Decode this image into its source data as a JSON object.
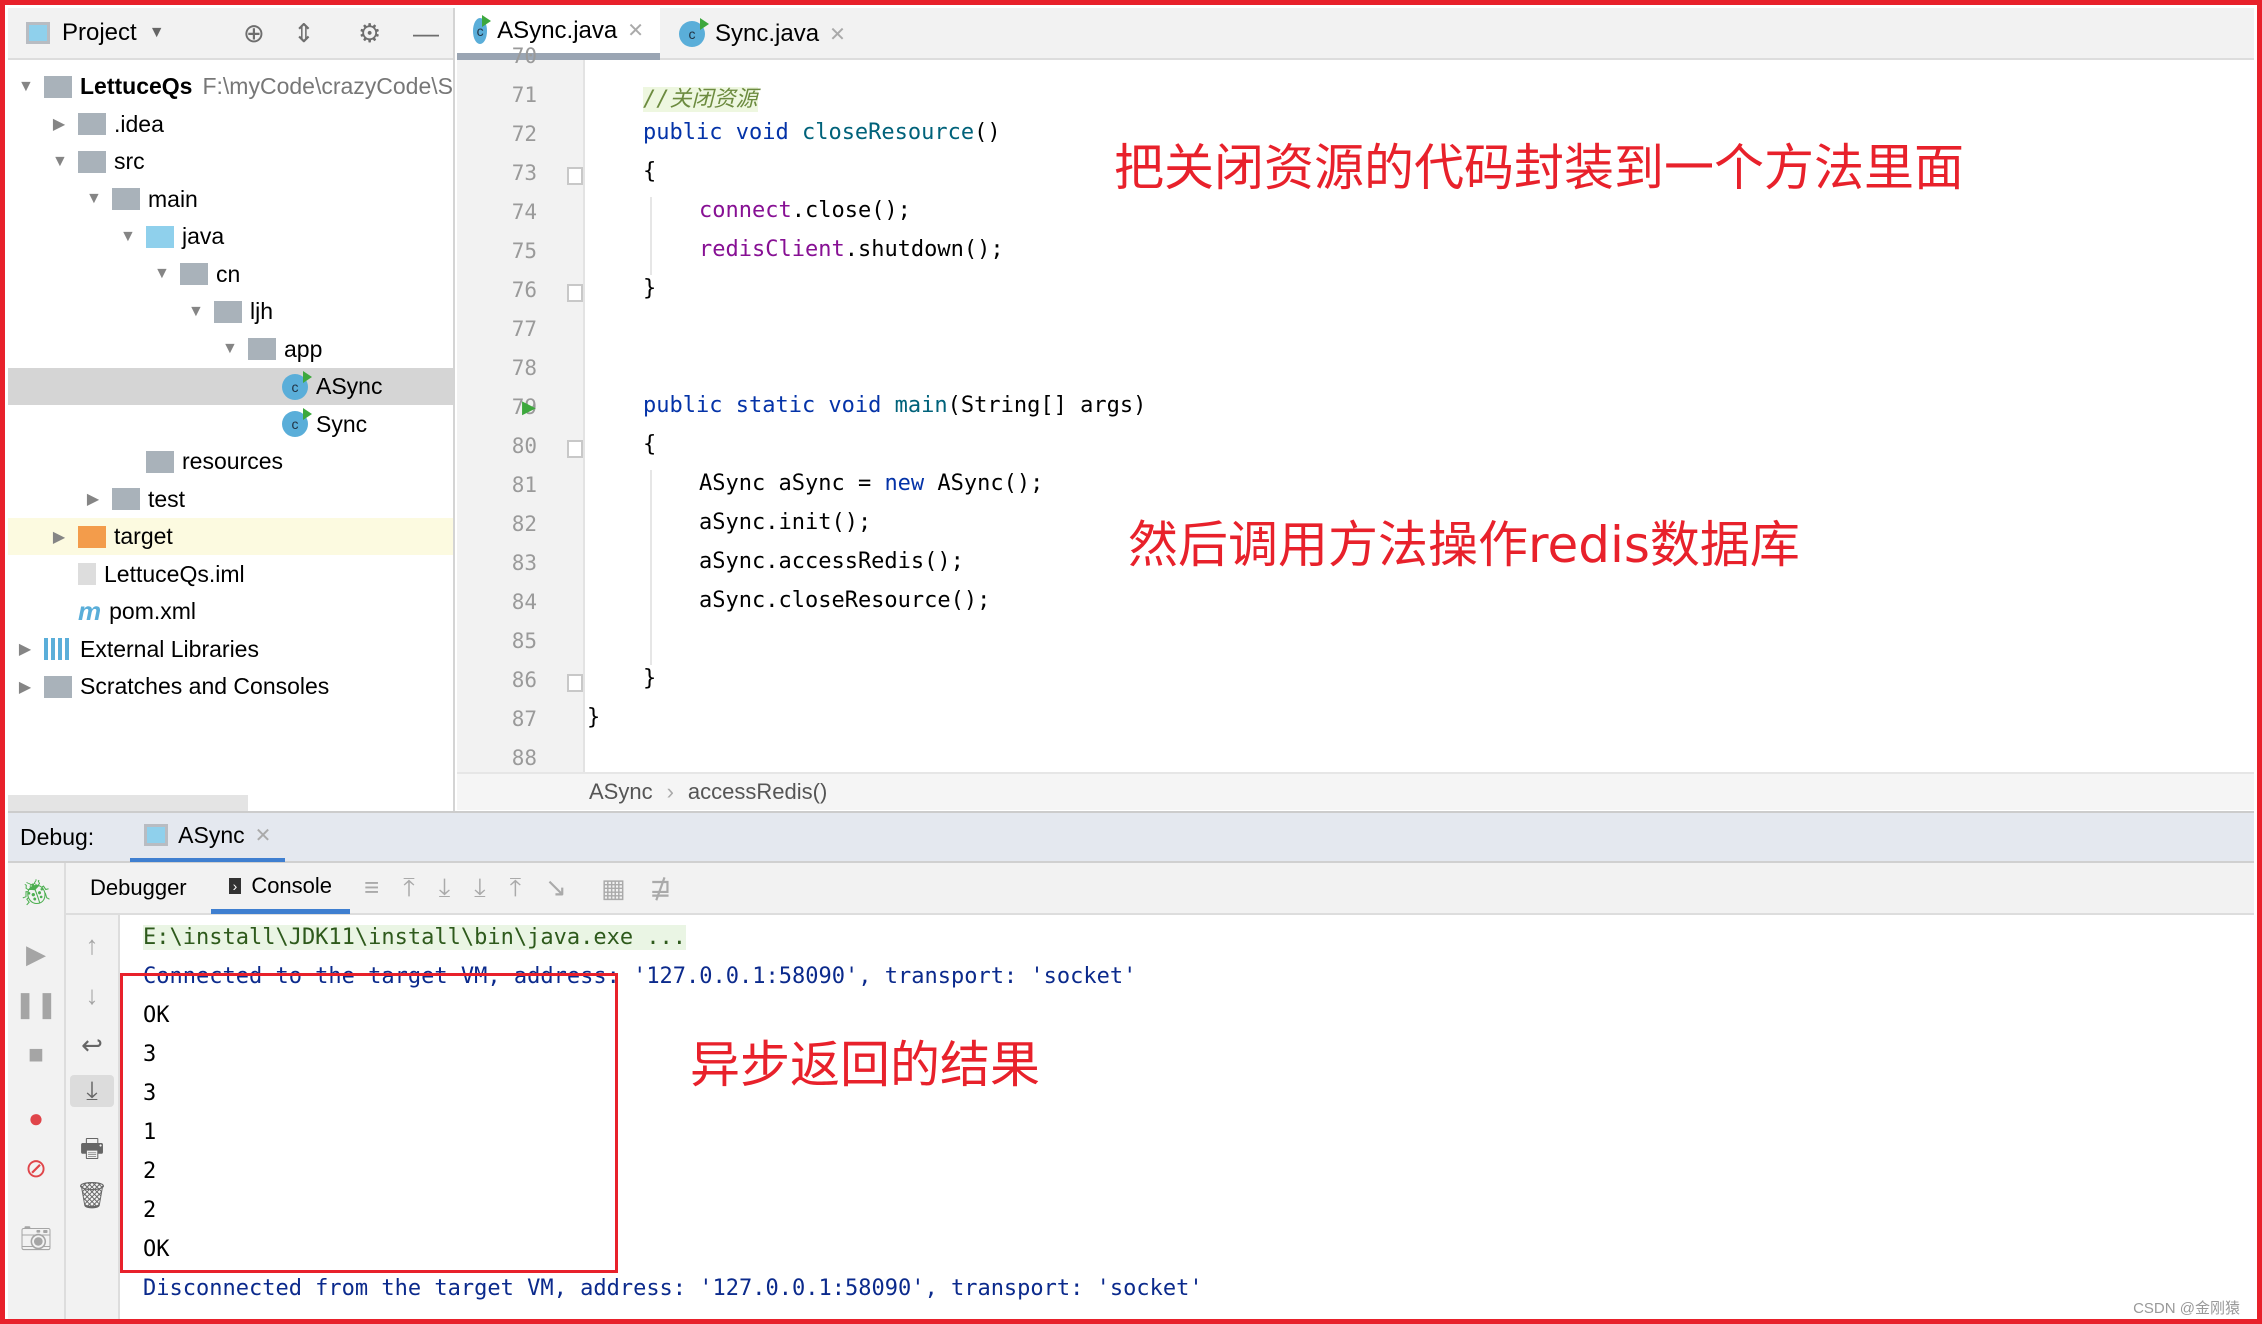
{
  "project_panel": {
    "title": "Project",
    "tree": [
      {
        "label": "LettuceQs",
        "path": "F:\\myCode\\crazyCode\\S",
        "depth": 0,
        "arrow": "down",
        "icon": "module-icon",
        "bold": true
      },
      {
        "label": ".idea",
        "depth": 1,
        "arrow": "right",
        "icon": "folder-icon"
      },
      {
        "label": "src",
        "depth": 1,
        "arrow": "down",
        "icon": "folder-icon"
      },
      {
        "label": "main",
        "depth": 2,
        "arrow": "down",
        "icon": "folder-icon"
      },
      {
        "label": "java",
        "depth": 3,
        "arrow": "down",
        "icon": "source-folder-icon"
      },
      {
        "label": "cn",
        "depth": 4,
        "arrow": "down",
        "icon": "package-icon"
      },
      {
        "label": "ljh",
        "depth": 5,
        "arrow": "down",
        "icon": "package-icon"
      },
      {
        "label": "app",
        "depth": 6,
        "arrow": "down",
        "icon": "package-icon"
      },
      {
        "label": "ASync",
        "depth": 7,
        "arrow": "",
        "icon": "java-class-icon",
        "selected": true
      },
      {
        "label": "Sync",
        "depth": 7,
        "arrow": "",
        "icon": "java-class-icon"
      },
      {
        "label": "resources",
        "depth": 3,
        "arrow": "",
        "icon": "resources-folder-icon"
      },
      {
        "label": "test",
        "depth": 2,
        "arrow": "right",
        "icon": "folder-icon"
      },
      {
        "label": "target",
        "depth": 1,
        "arrow": "right",
        "icon": "excluded-folder-icon",
        "highlight": true
      },
      {
        "label": "LettuceQs.iml",
        "depth": 1,
        "arrow": "",
        "icon": "iml-file-icon"
      },
      {
        "label": "pom.xml",
        "depth": 1,
        "arrow": "",
        "icon": "maven-icon"
      },
      {
        "label": "External Libraries",
        "depth": 0,
        "arrow": "right",
        "icon": "libraries-icon"
      },
      {
        "label": "Scratches and Consoles",
        "depth": 0,
        "arrow": "right",
        "icon": "scratches-icon"
      }
    ]
  },
  "editor": {
    "tabs": [
      {
        "label": "ASync.java",
        "active": true
      },
      {
        "label": "Sync.java",
        "active": false
      }
    ],
    "lines": [
      {
        "n": "70",
        "t": []
      },
      {
        "n": "71",
        "t": [
          {
            "c": "cm",
            "s": "//关闭资源"
          }
        ],
        "i": 1
      },
      {
        "n": "72",
        "t": [
          {
            "c": "kw",
            "s": "public void "
          },
          {
            "c": "fn",
            "s": "closeResource"
          },
          {
            "c": "",
            "s": "()"
          }
        ],
        "i": 1
      },
      {
        "n": "73",
        "t": [
          {
            "c": "",
            "s": "{"
          }
        ],
        "i": 1,
        "fold": true
      },
      {
        "n": "74",
        "t": [
          {
            "c": "fd",
            "s": "connect"
          },
          {
            "c": "",
            "s": ".close();"
          }
        ],
        "i": 2
      },
      {
        "n": "75",
        "t": [
          {
            "c": "fd",
            "s": "redisClient"
          },
          {
            "c": "",
            "s": ".shutdown();"
          }
        ],
        "i": 2
      },
      {
        "n": "76",
        "t": [
          {
            "c": "",
            "s": "}"
          }
        ],
        "i": 1,
        "fold": true
      },
      {
        "n": "77",
        "t": []
      },
      {
        "n": "78",
        "t": []
      },
      {
        "n": "79",
        "t": [
          {
            "c": "kw",
            "s": "public static void "
          },
          {
            "c": "fn",
            "s": "main"
          },
          {
            "c": "",
            "s": "(String[] args)"
          }
        ],
        "i": 1,
        "run": true
      },
      {
        "n": "80",
        "t": [
          {
            "c": "",
            "s": "{"
          }
        ],
        "i": 1,
        "fold": true
      },
      {
        "n": "81",
        "t": [
          {
            "c": "",
            "s": "ASync aSync = "
          },
          {
            "c": "kw",
            "s": "new"
          },
          {
            "c": "",
            "s": " ASync();"
          }
        ],
        "i": 2
      },
      {
        "n": "82",
        "t": [
          {
            "c": "",
            "s": "aSync.init();"
          }
        ],
        "i": 2
      },
      {
        "n": "83",
        "t": [
          {
            "c": "",
            "s": "aSync.accessRedis();"
          }
        ],
        "i": 2
      },
      {
        "n": "84",
        "t": [
          {
            "c": "",
            "s": "aSync.closeResource();"
          }
        ],
        "i": 2
      },
      {
        "n": "85",
        "t": []
      },
      {
        "n": "86",
        "t": [
          {
            "c": "",
            "s": "}"
          }
        ],
        "i": 1,
        "fold": true
      },
      {
        "n": "87",
        "t": [
          {
            "c": "",
            "s": "}"
          }
        ],
        "i": 0
      },
      {
        "n": "88",
        "t": []
      }
    ],
    "breadcrumb": [
      "ASync",
      "accessRedis()"
    ]
  },
  "debug": {
    "label": "Debug:",
    "session": "ASync",
    "tabs": [
      "Debugger",
      "Console"
    ],
    "console": [
      {
        "s": "E:\\install\\JDK11\\install\\bin\\java.exe ...",
        "c": "cmd"
      },
      {
        "s": "Connected to the target VM, address: '127.0.0.1:58090', transport: 'socket'",
        "c": "sys"
      },
      {
        "s": "OK",
        "c": ""
      },
      {
        "s": "3",
        "c": ""
      },
      {
        "s": "3",
        "c": ""
      },
      {
        "s": "1",
        "c": ""
      },
      {
        "s": "2",
        "c": ""
      },
      {
        "s": "2",
        "c": ""
      },
      {
        "s": "OK",
        "c": ""
      },
      {
        "s": "Disconnected from the target VM, address: '127.0.0.1:58090', transport: 'socket'",
        "c": "sys"
      }
    ]
  },
  "annotations": {
    "a1": "把关闭资源的代码封装到一个方法里面",
    "a2": "然后调用方法操作redis数据库",
    "a3": "异步返回的结果"
  },
  "watermark": "CSDN @金刚猿",
  "colors": {
    "annotation": "#e8212b",
    "keyword": "#0433a8",
    "field": "#871094",
    "console_sys": "#0b2a8c"
  }
}
